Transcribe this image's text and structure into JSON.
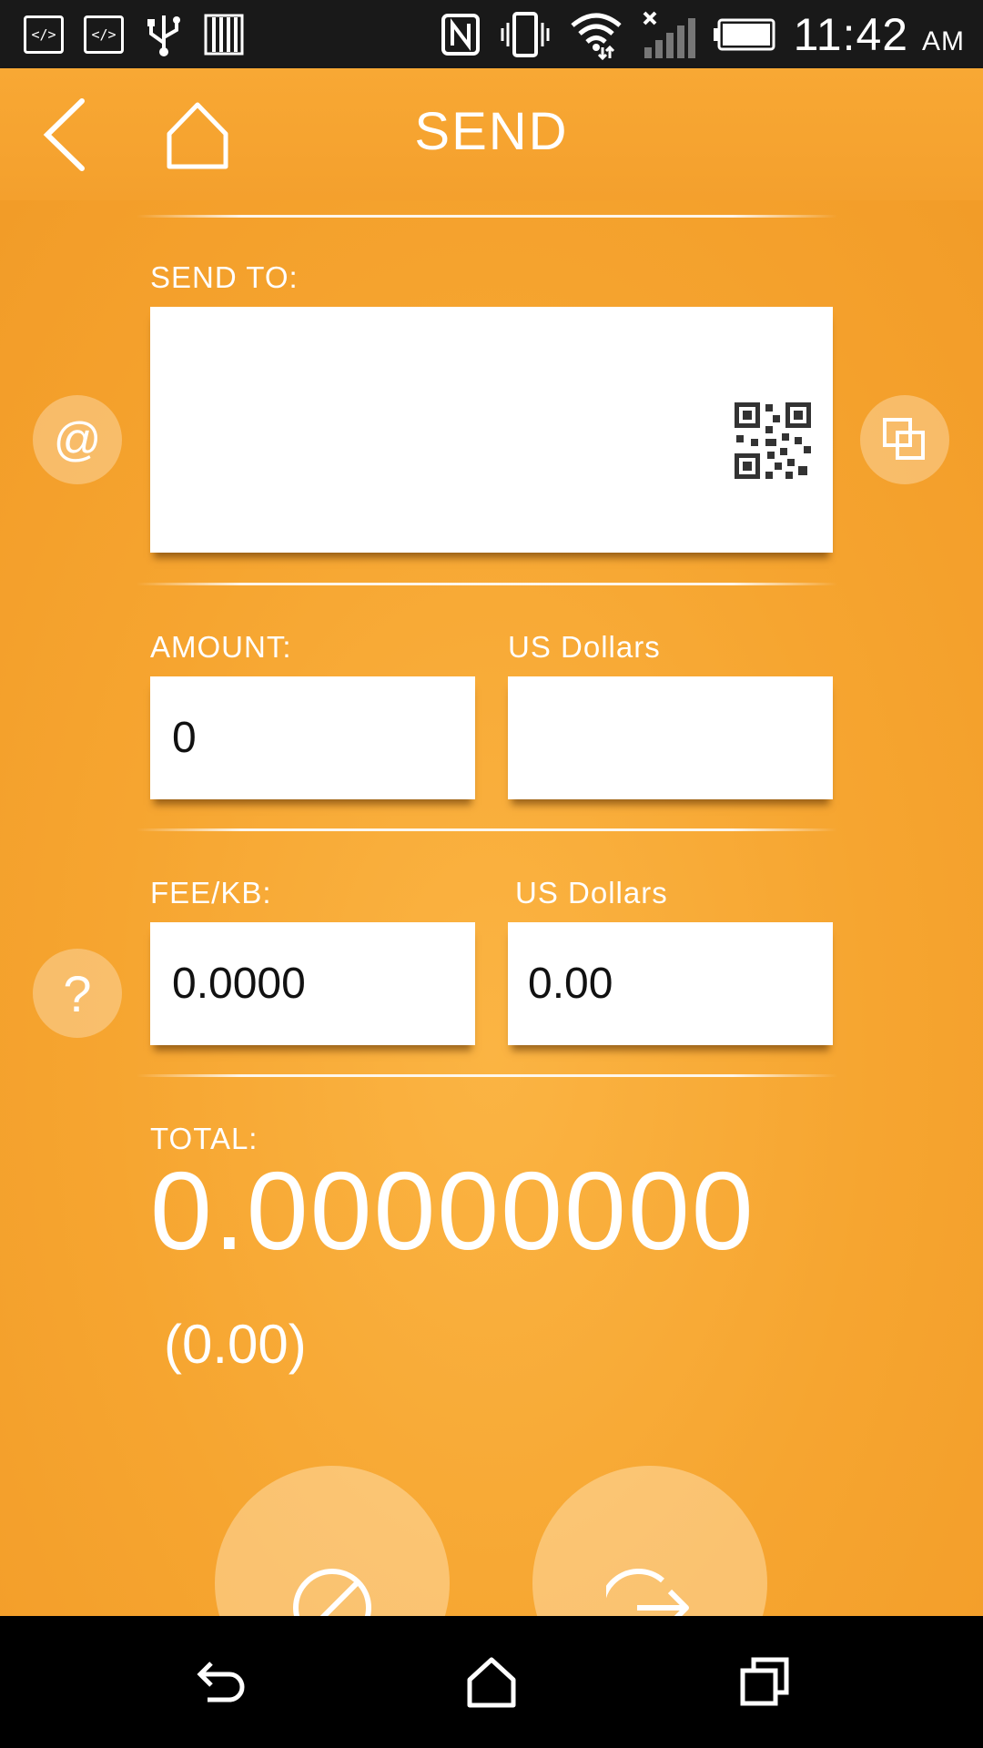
{
  "status_bar": {
    "time": "11:42",
    "ampm": "AM",
    "dev_icon_1": "</>",
    "dev_icon_2": "</>"
  },
  "app_bar": {
    "title": "SEND"
  },
  "form": {
    "send_to_label": "SEND TO:",
    "send_to_value": "",
    "amount_label": "AMOUNT:",
    "amount_value": "0",
    "amount_usd_label": "US Dollars",
    "amount_usd_value": "",
    "fee_label": "FEE/KB:",
    "fee_value": "0.0000",
    "fee_usd_label": "US Dollars",
    "fee_usd_value": "0.00"
  },
  "total": {
    "label": "TOTAL:",
    "value": "0.00000000",
    "usd": "(0.00)"
  },
  "icons": {
    "back": "back-chevron-icon",
    "home": "home-icon",
    "at": "at-sign-icon",
    "qr": "qr-code-icon",
    "copy": "copy-icon",
    "help": "question-icon",
    "cancel": "cancel-icon",
    "send": "send-arrow-icon"
  },
  "colors": {
    "accent": "#f5a42e",
    "status_bar": "#191919"
  }
}
